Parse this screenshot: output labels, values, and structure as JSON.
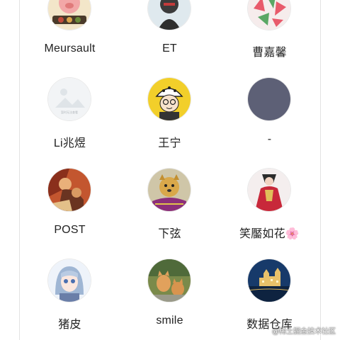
{
  "contacts": [
    {
      "name": "Meursault",
      "avatar": "cartoon-pig-avatar"
    },
    {
      "name": "ET",
      "avatar": "dark-figure-avatar"
    },
    {
      "name": "曹嘉馨",
      "avatar": "watermelon-slices-avatar"
    },
    {
      "name": "Li兆煜",
      "avatar": "placeholder-image-avatar"
    },
    {
      "name": "王宁",
      "avatar": "cartoon-boy-hat-avatar"
    },
    {
      "name": "-",
      "avatar": "solid-slate-avatar"
    },
    {
      "name": "POST",
      "avatar": "painting-avatar"
    },
    {
      "name": "下弦",
      "avatar": "golden-dog-avatar"
    },
    {
      "name": "笑靨如花🌸",
      "avatar": "woman-red-dress-avatar"
    },
    {
      "name": "猪皮",
      "avatar": "anime-girl-avatar"
    },
    {
      "name": "smile",
      "avatar": "two-cats-avatar"
    },
    {
      "name": "数据仓库",
      "avatar": "night-castle-avatar"
    }
  ],
  "placeholder_avatar_text": "暂时无法查看",
  "watermark": "@稀土掘金技术社区",
  "colors": {
    "background": "#ffffff",
    "text": "#222222",
    "divider": "#e2e2e2"
  }
}
